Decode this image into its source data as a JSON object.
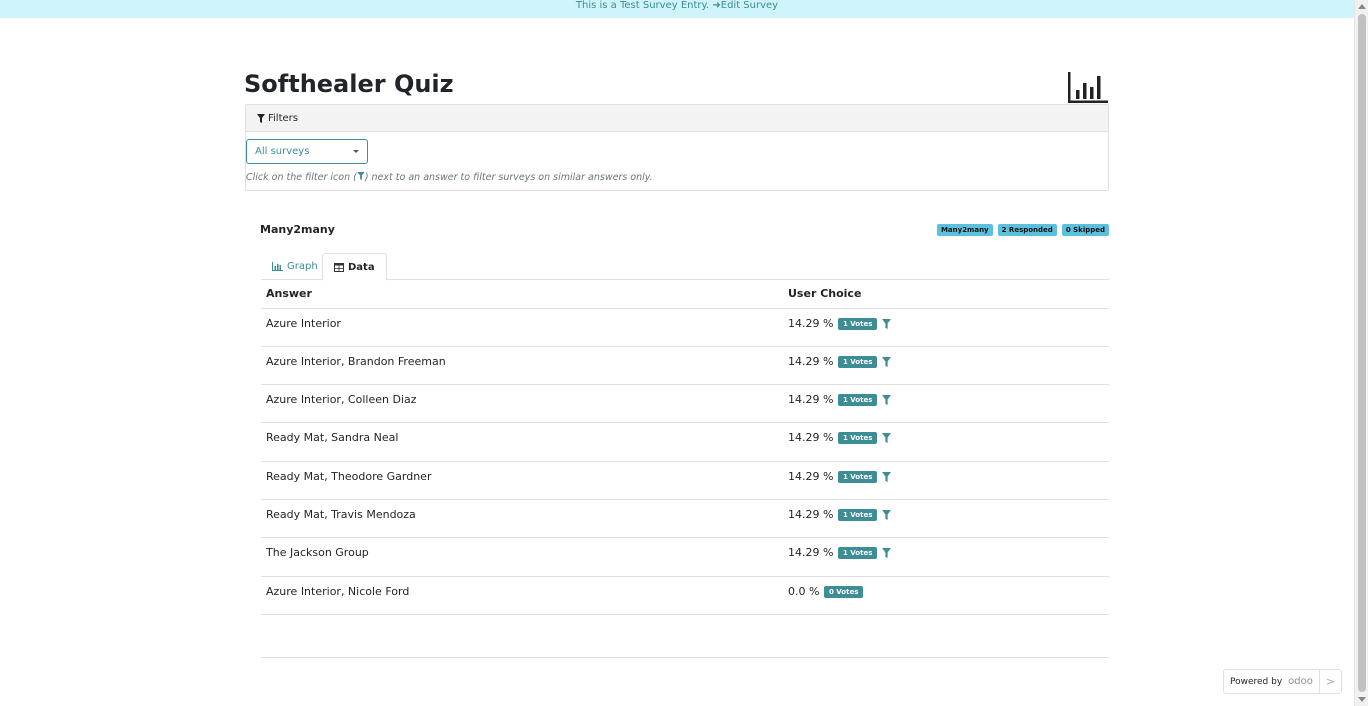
{
  "banner": {
    "text": "This is a Test Survey Entry.",
    "arrow": "➜",
    "link_label": "Edit Survey"
  },
  "page": {
    "title": "Softhealer Quiz"
  },
  "filters": {
    "header_label": "Filters",
    "select_value": "All surveys",
    "hint_before": "Click on the filter icon (",
    "hint_after": ") next to an answer to filter surveys on similar answers only."
  },
  "question": {
    "title": "Many2many",
    "badges": [
      "Many2many",
      "2 Responded",
      "0 Skipped"
    ],
    "tabs": [
      {
        "label": "Graph"
      },
      {
        "label": "Data"
      }
    ],
    "table": {
      "headers": [
        "Answer",
        "User Choice"
      ],
      "rows": [
        {
          "answer": "Azure Interior",
          "percent": "14.29 %",
          "votes": "1 Votes",
          "filterable": true
        },
        {
          "answer": "Azure Interior, Brandon Freeman",
          "percent": "14.29 %",
          "votes": "1 Votes",
          "filterable": true
        },
        {
          "answer": "Azure Interior, Colleen Diaz",
          "percent": "14.29 %",
          "votes": "1 Votes",
          "filterable": true
        },
        {
          "answer": "Ready Mat, Sandra Neal",
          "percent": "14.29 %",
          "votes": "1 Votes",
          "filterable": true
        },
        {
          "answer": "Ready Mat, Theodore Gardner",
          "percent": "14.29 %",
          "votes": "1 Votes",
          "filterable": true
        },
        {
          "answer": "Ready Mat, Travis Mendoza",
          "percent": "14.29 %",
          "votes": "1 Votes",
          "filterable": true
        },
        {
          "answer": "The Jackson Group",
          "percent": "14.29 %",
          "votes": "1 Votes",
          "filterable": true
        },
        {
          "answer": "Azure Interior, Nicole Ford",
          "percent": "0.0 %",
          "votes": "0 Votes",
          "filterable": false
        }
      ]
    }
  },
  "footer": {
    "powered_label": "Powered by",
    "brand": "odoo",
    "next_glyph": ">"
  },
  "colors": {
    "accent": "#3c8d96",
    "banner_bg": "#cff4fc",
    "badge_info": "#5bc0de"
  }
}
